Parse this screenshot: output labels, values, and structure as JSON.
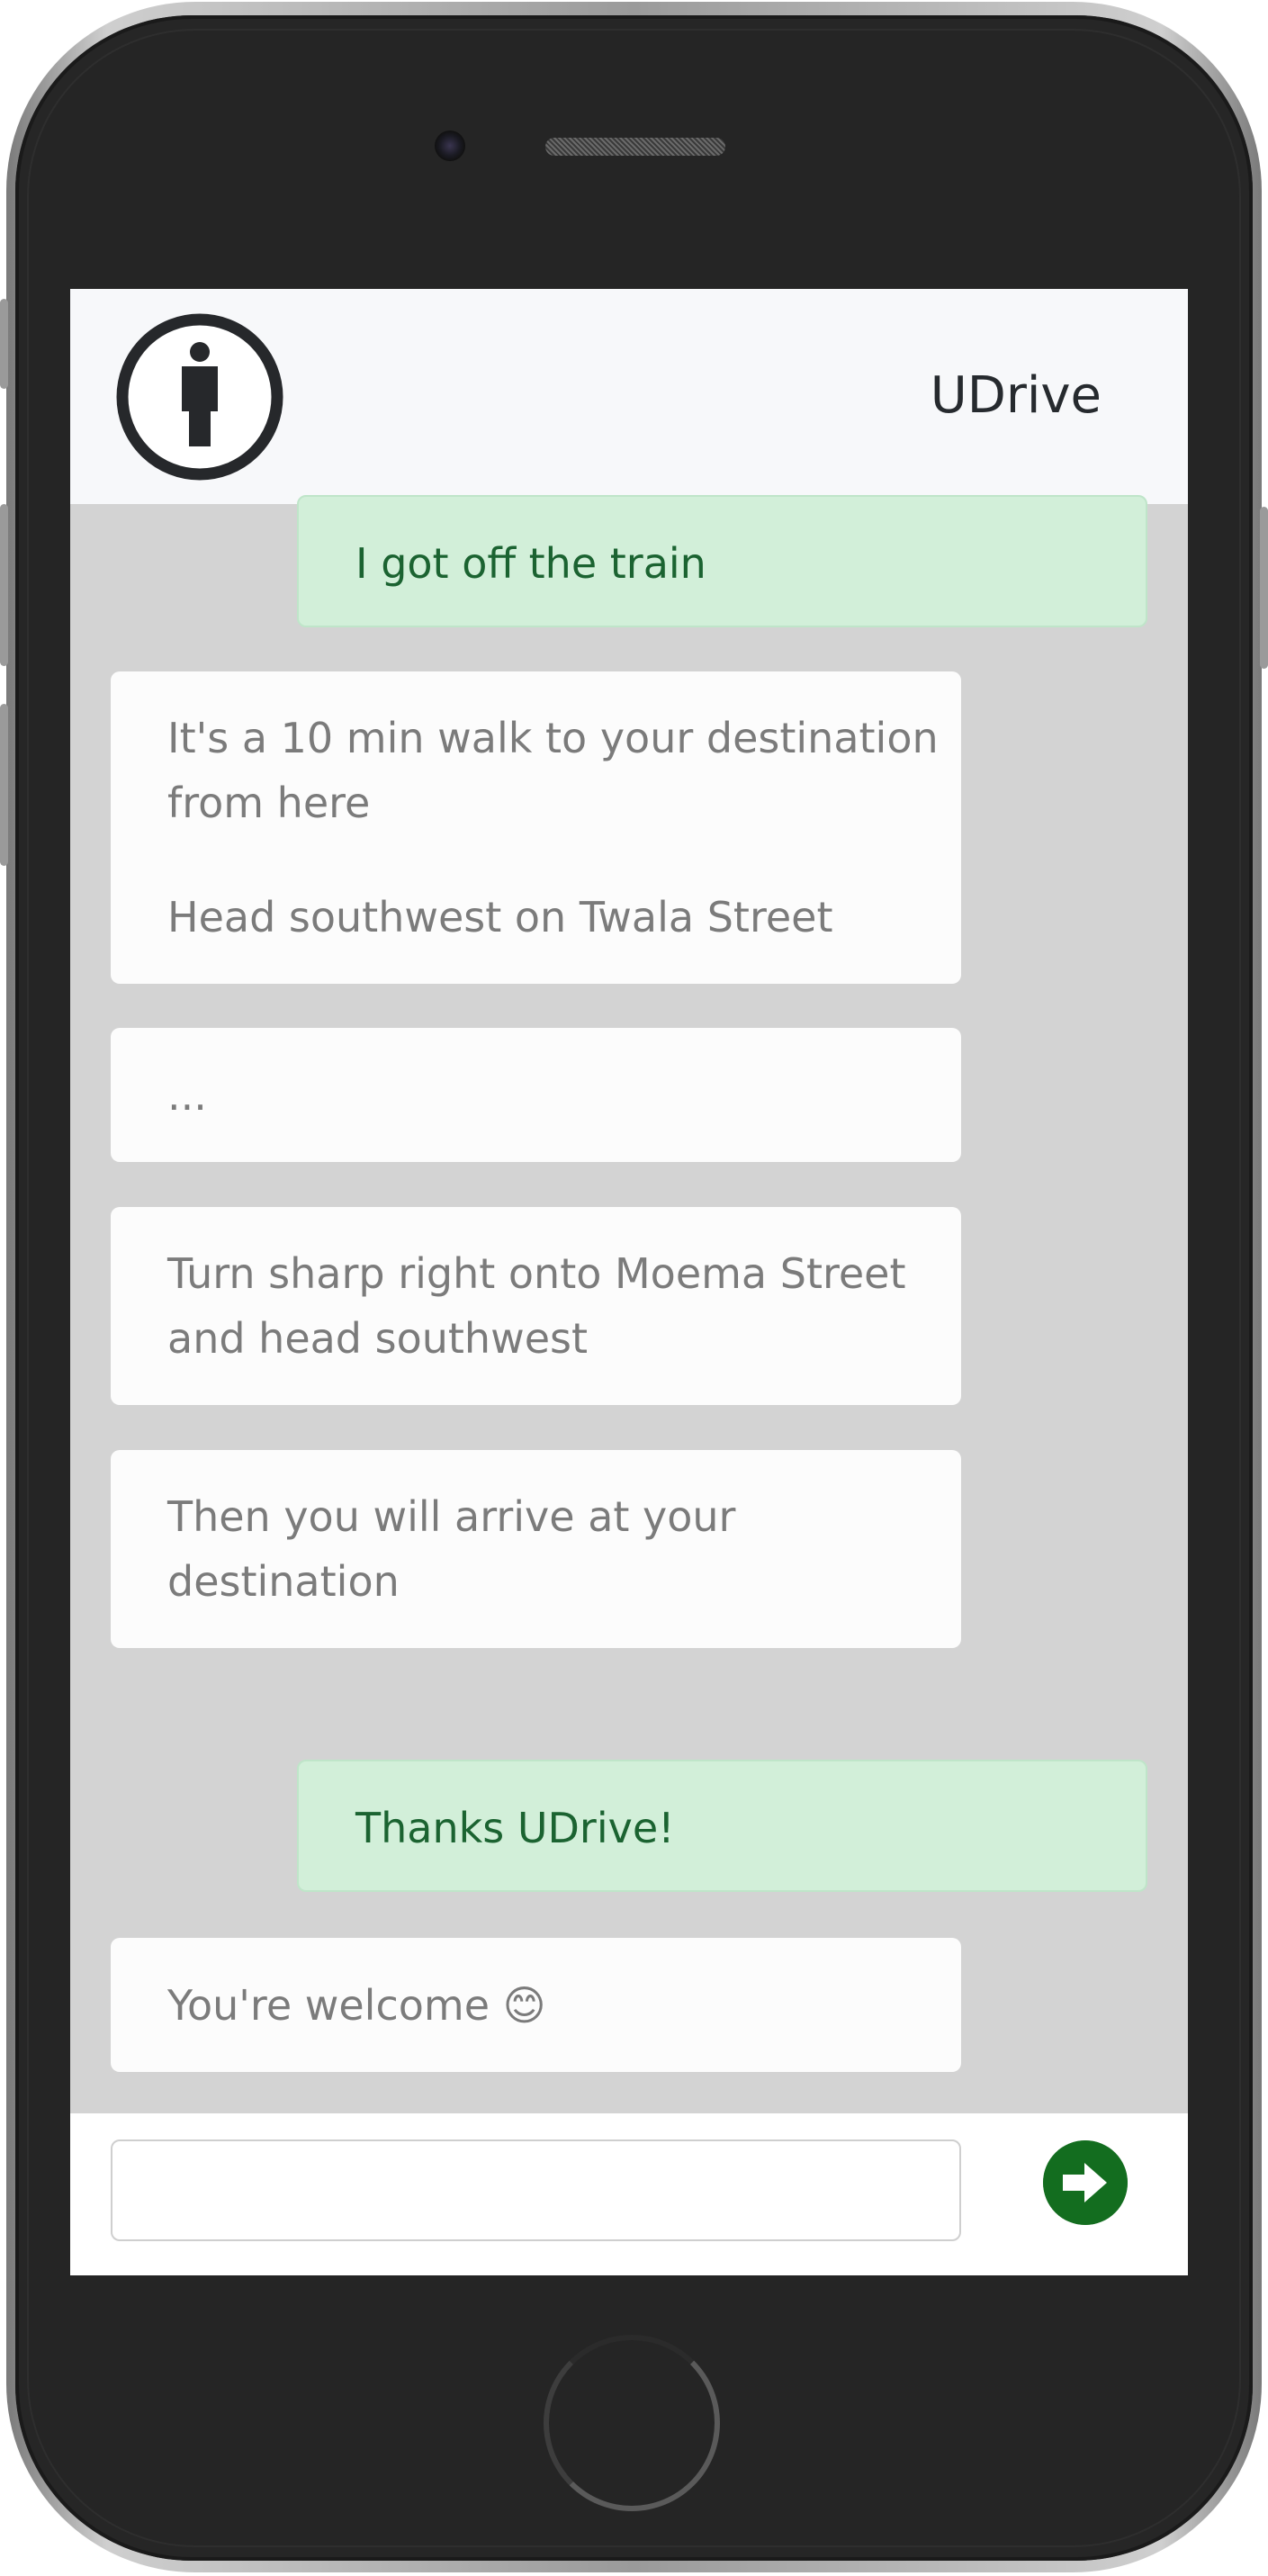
{
  "app": {
    "title": "UDrive",
    "logo_icon": "info-person-icon"
  },
  "colors": {
    "header_bg": "#f7f8fa",
    "chat_bg": "#d3d3d3",
    "bot_bubble_bg": "#fcfcfc",
    "bot_text": "#7b7b7b",
    "user_bubble_bg": "#d2efd9",
    "user_text": "#1b6331",
    "send_button": "#136d1f"
  },
  "messages": [
    {
      "from": "user",
      "lines": [
        "I got off the train"
      ]
    },
    {
      "from": "bot",
      "lines": [
        "It's a 10 min walk to your destination",
        "from here"
      ]
    },
    {
      "from": "bot",
      "lines": [
        "Head southwest on Twala Street"
      ]
    },
    {
      "from": "bot",
      "lines": [
        "..."
      ]
    },
    {
      "from": "bot",
      "lines": [
        "Turn sharp right onto Moema Street",
        "and head southwest"
      ]
    },
    {
      "from": "bot",
      "lines": [
        "Then you will arrive at your",
        "destination"
      ]
    },
    {
      "from": "user",
      "lines": [
        "Thanks UDrive!"
      ]
    },
    {
      "from": "bot",
      "lines": [
        "You're welcome 😊"
      ]
    }
  ],
  "composer": {
    "value": "",
    "placeholder": "",
    "send_icon": "arrow-right-circle-icon"
  }
}
